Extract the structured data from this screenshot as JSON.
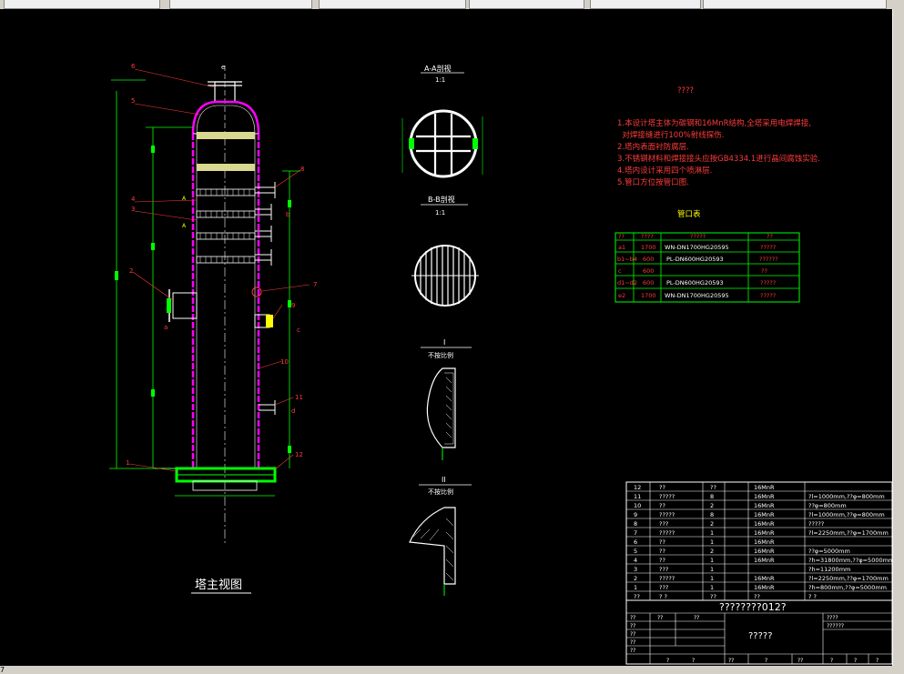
{
  "main_view": {
    "title": "塔主视图",
    "callouts": [
      "6",
      "5",
      "4",
      "3",
      "2",
      "1",
      "8",
      "b",
      "a",
      "9",
      "c",
      "10",
      "11",
      "d",
      "12",
      "e",
      "7",
      "A",
      "A"
    ]
  },
  "section_aa": {
    "title": "A-A剖视",
    "scale": "1:1"
  },
  "section_bb": {
    "title": "B-B剖视",
    "scale": "1:1"
  },
  "detail_1": {
    "title": "I",
    "scale": "不按比例"
  },
  "detail_2": {
    "title": "II",
    "scale": "不按比例"
  },
  "notes": {
    "title": "????",
    "lines": [
      "1.本设计塔主体为碳钢和16MnR结构,全塔采用电焊焊接,",
      "  对焊接缝进行100%射线探伤.",
      "2.塔内表面衬防腐层.",
      "3.不锈钢材料和焊接接头应按GB4334.1进行晶间腐蚀实验.",
      "4.塔内设计采用四个喷淋层.",
      "5.管口方位按管口图."
    ]
  },
  "nozzle_table": {
    "title": "管口表",
    "header": [
      "??",
      "????",
      "?????",
      "??"
    ],
    "rows": [
      [
        "a1",
        "1700",
        "WN-DN1700HG20595",
        "?????"
      ],
      [
        "b1~b4",
        "600",
        "PL-DN600HG20593",
        "??????"
      ],
      [
        "c",
        "600",
        "",
        "??"
      ],
      [
        "d1~d2",
        "600",
        "PL-DN600HG20593",
        "?????"
      ],
      [
        "e2",
        "1700",
        "WN-DN1700HG20595",
        "?????"
      ]
    ]
  },
  "parts_list": {
    "rows": [
      [
        "12",
        "??",
        "??",
        "",
        "16MnR",
        ""
      ],
      [
        "11",
        "?????",
        "8",
        "",
        "16MnR",
        "?l=1000mm,??φ=800mm"
      ],
      [
        "10",
        "??",
        "2",
        "",
        "16MnR",
        "??φ=800mm"
      ],
      [
        "9",
        "?????",
        "8",
        "",
        "16MnR",
        "?l=1000mm,??φ=800mm"
      ],
      [
        "8",
        "???",
        "2",
        "",
        "16MnR",
        "?????"
      ],
      [
        "7",
        "?????",
        "1",
        "",
        "16MnR",
        "?l=2250mm,??φ=1700mm"
      ],
      [
        "6",
        "??",
        "1",
        "",
        "16MnR",
        ""
      ],
      [
        "5",
        "??",
        "2",
        "",
        "16MnR",
        "??φ=5000mm"
      ],
      [
        "4",
        "??",
        "1",
        "",
        "16MnR",
        "?h=31800mm,??φ=5000mm"
      ],
      [
        "3",
        "???",
        "1",
        "",
        "",
        "?h=11200mm"
      ],
      [
        "2",
        "?????",
        "1",
        "",
        "16MnR",
        "?l=2250mm,??φ=1700mm"
      ],
      [
        "1",
        "???",
        "1",
        "",
        "16MnR",
        "?h=800mm,??φ=5000mm"
      ],
      [
        "??",
        "? ?",
        "??",
        "",
        "??",
        "? ?"
      ]
    ]
  },
  "title_block": {
    "drawing_no": "????????012?",
    "drawing_name": "?????",
    "left_labels": [
      "??",
      "??",
      "??",
      "??",
      "??"
    ],
    "left_cells": [
      "??",
      "??"
    ],
    "right_labels": [
      "????",
      "??????"
    ],
    "bottom_labels": [
      "?",
      "?",
      "??",
      "?",
      "??",
      "?",
      "?",
      "?"
    ]
  },
  "status_text": "7",
  "colors": {
    "background": "#000000",
    "outline": "#ffffff",
    "shell": "#ff00ff",
    "dimension": "#00ff00",
    "text_red": "#ff3b3b",
    "text_yellow": "#ffff00",
    "packing": "#d8d890"
  }
}
